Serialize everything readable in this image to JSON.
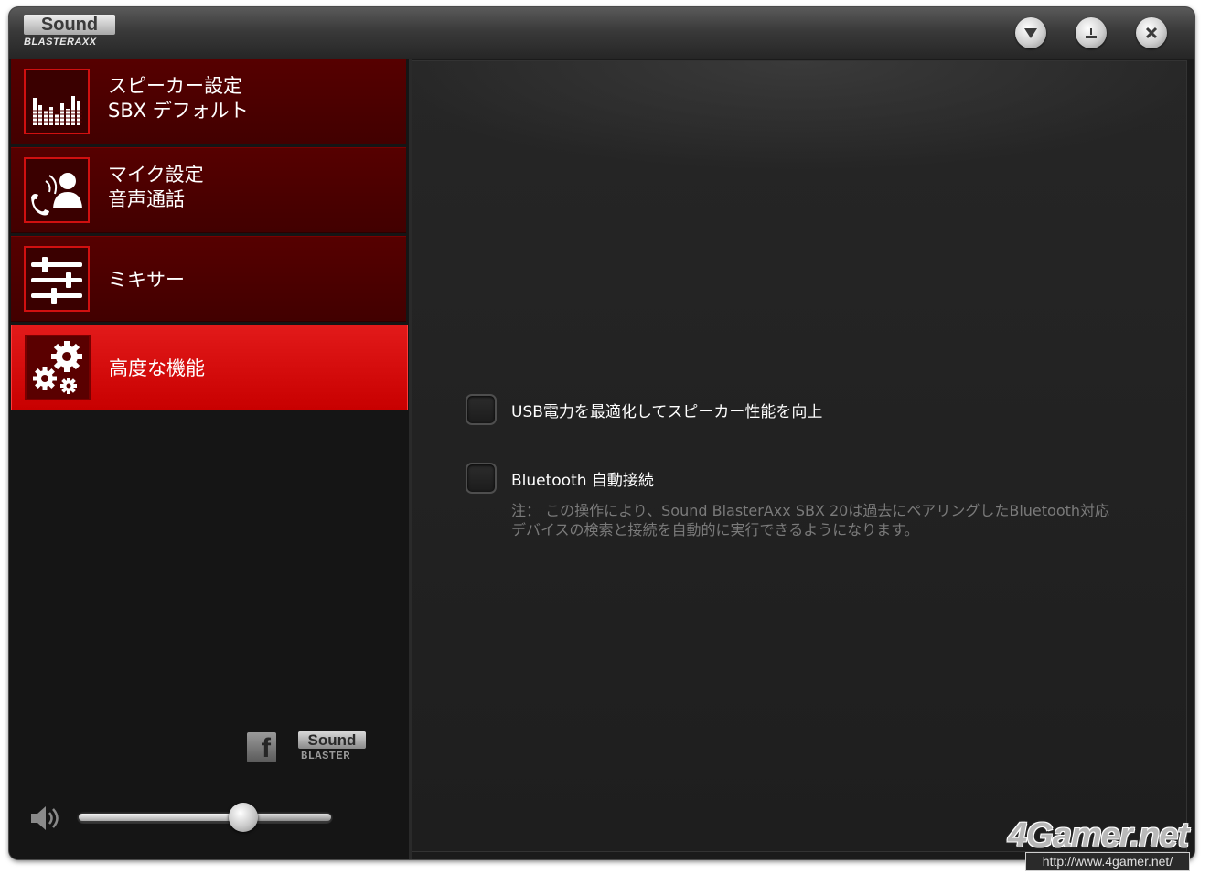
{
  "app": {
    "logo_text": "Sound",
    "logo_subtext": "BLASTERAXX"
  },
  "titlebar": {
    "buttons": [
      {
        "icon": "triangle-down-icon"
      },
      {
        "icon": "minimize-icon"
      },
      {
        "icon": "close-icon"
      }
    ]
  },
  "sidebar": {
    "items": [
      {
        "line1": "スピーカー設定",
        "line2": "SBX デフォルト",
        "icon": "equalizer-bars-icon",
        "active": false
      },
      {
        "line1": "マイク設定",
        "line2": "音声通話",
        "icon": "voice-call-icon",
        "active": false
      },
      {
        "line1": "ミキサー",
        "line2": "",
        "icon": "mixer-sliders-icon",
        "active": false
      },
      {
        "line1": "高度な機能",
        "line2": "",
        "icon": "gears-icon",
        "active": true
      }
    ],
    "social": {
      "facebook_glyph": "f",
      "brand_text": "Sound",
      "brand_subtext": "BLASTER"
    },
    "volume": {
      "level": 0.65
    }
  },
  "content": {
    "options": [
      {
        "label": "USB電力を最適化してスピーカー性能を向上",
        "checked": false
      },
      {
        "label": "Bluetooth 自動接続",
        "checked": false
      }
    ],
    "note_line1": "注： この操作により、Sound BlasterAxx SBX 20は過去にペアリングしたBluetooth対応",
    "note_line2": "デバイスの検索と接続を自動的に実行できるようになります。"
  },
  "watermark": {
    "logo": "4Gamer.net",
    "url": "http://www.4gamer.net/"
  },
  "colors": {
    "accent_red": "#d40000",
    "menu_dark_red": "#4a0000",
    "background": "#1b1b1b"
  }
}
